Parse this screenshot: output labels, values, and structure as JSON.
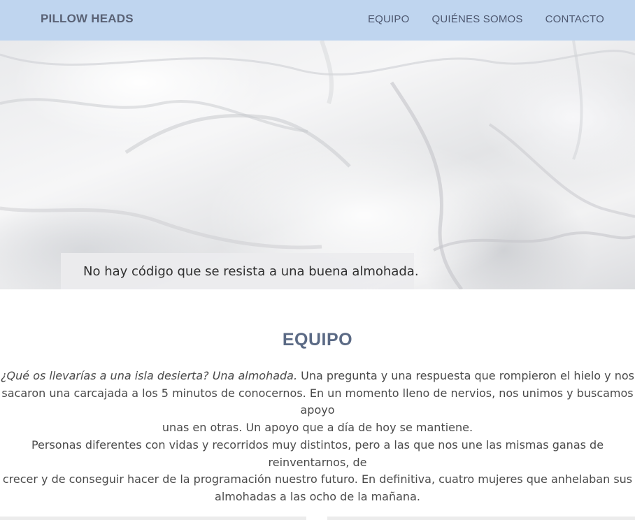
{
  "navbar": {
    "brand": "PILLOW HEADS",
    "links": [
      "EQUIPO",
      "QUIÉNES SOMOS",
      "CONTACTO"
    ]
  },
  "hero": {
    "caption": "No hay código que se resista a una buena almohada."
  },
  "team": {
    "title": "EQUIPO",
    "p1_italic": "¿Qué os llevarías a una isla desierta? Una almohada.",
    "p1_l1": " Una pregunta y una respuesta que rompieron el hielo y nos",
    "p1_l2": "sacaron una carcajada a los 5 minutos de conocernos. En un momento lleno de nervios, nos unimos y buscamos apoyo",
    "p1_l3": "unas en otras. Un apoyo que a día de hoy se mantiene.",
    "p2_l1": "Personas diferentes con vidas y recorridos muy distintos, pero a las que nos une las mismas ganas de reinventarnos, de",
    "p2_l2": "crecer y de conseguir hacer de la programación nuestro futuro. En definitiva, cuatro mujeres que anhelaban sus",
    "p2_l3": "almohadas a las ocho de la mañana."
  },
  "colors": {
    "navbar_bg": "#bfd5ef",
    "brand_text": "#5a6275",
    "title_text": "#5b6a85"
  }
}
